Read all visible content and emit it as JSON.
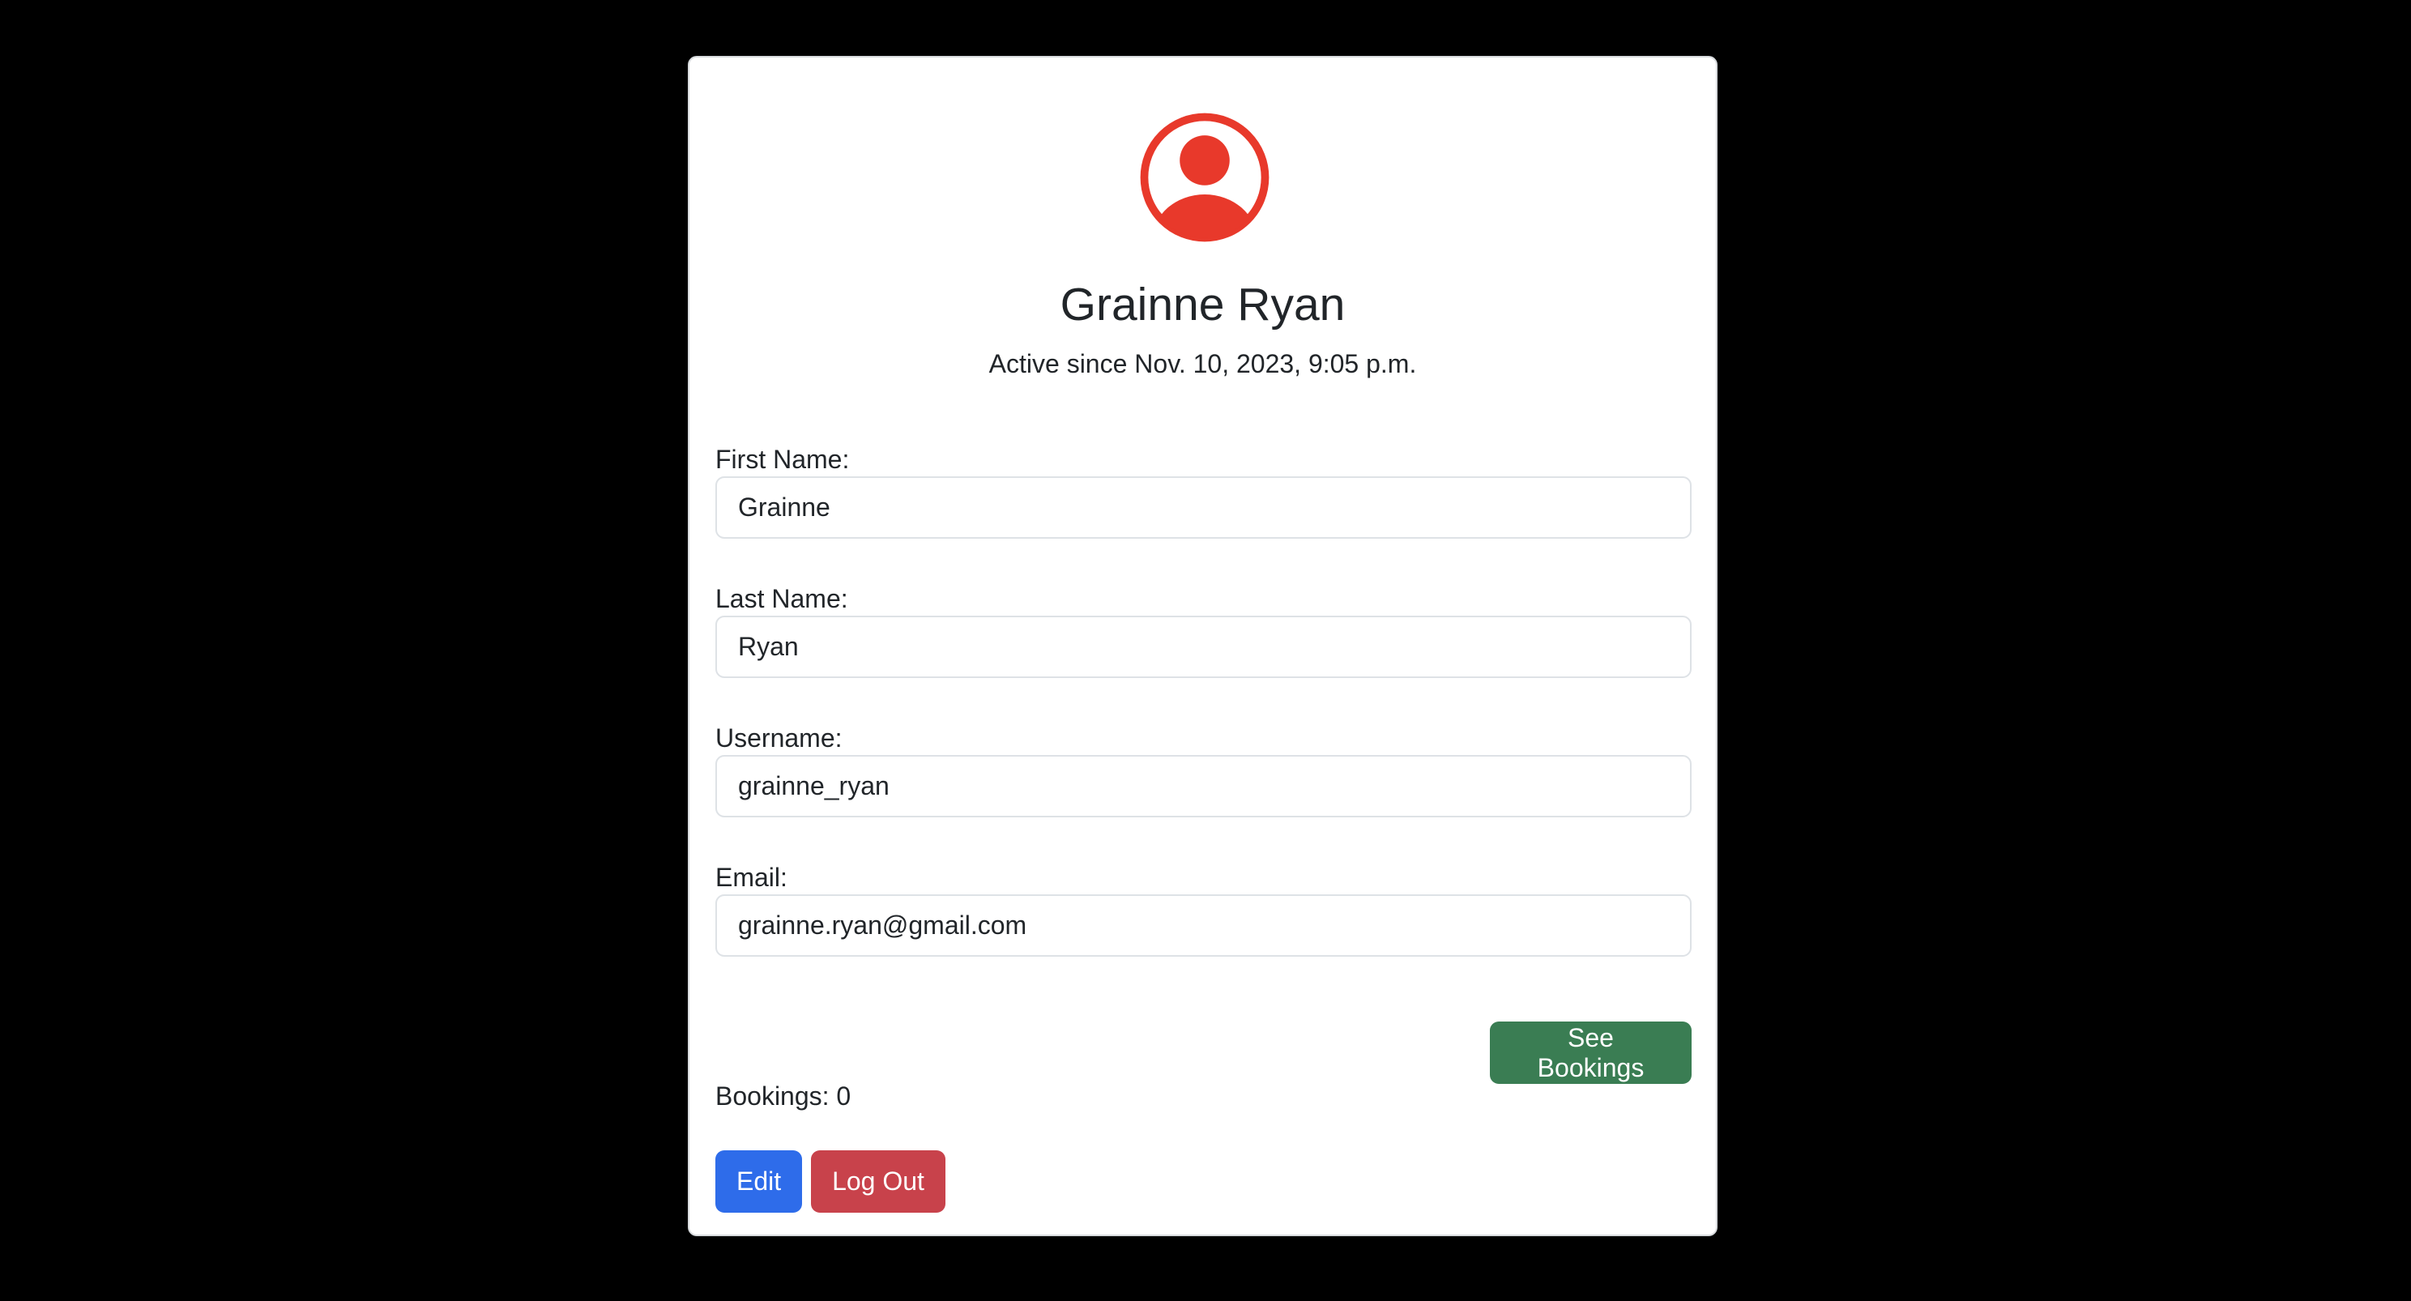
{
  "profile": {
    "name": "Grainne Ryan",
    "active_since": "Active since Nov. 10, 2023, 9:05 p.m."
  },
  "form": {
    "first_name_label": "First Name:",
    "first_name_value": "Grainne",
    "last_name_label": "Last Name:",
    "last_name_value": "Ryan",
    "username_label": "Username:",
    "username_value": "grainne_ryan",
    "email_label": "Email:",
    "email_value": "grainne.ryan@gmail.com"
  },
  "bookings": {
    "count_text": "Bookings: 0",
    "see_label": "See Bookings"
  },
  "actions": {
    "edit_label": "Edit",
    "logout_label": "Log Out"
  },
  "icons": {
    "avatar": "user-circle-icon"
  },
  "colors": {
    "avatar": "#e8392b",
    "see_bookings": "#3a7d53",
    "edit": "#2e6cea",
    "logout": "#c8424b",
    "background": "#000000"
  }
}
